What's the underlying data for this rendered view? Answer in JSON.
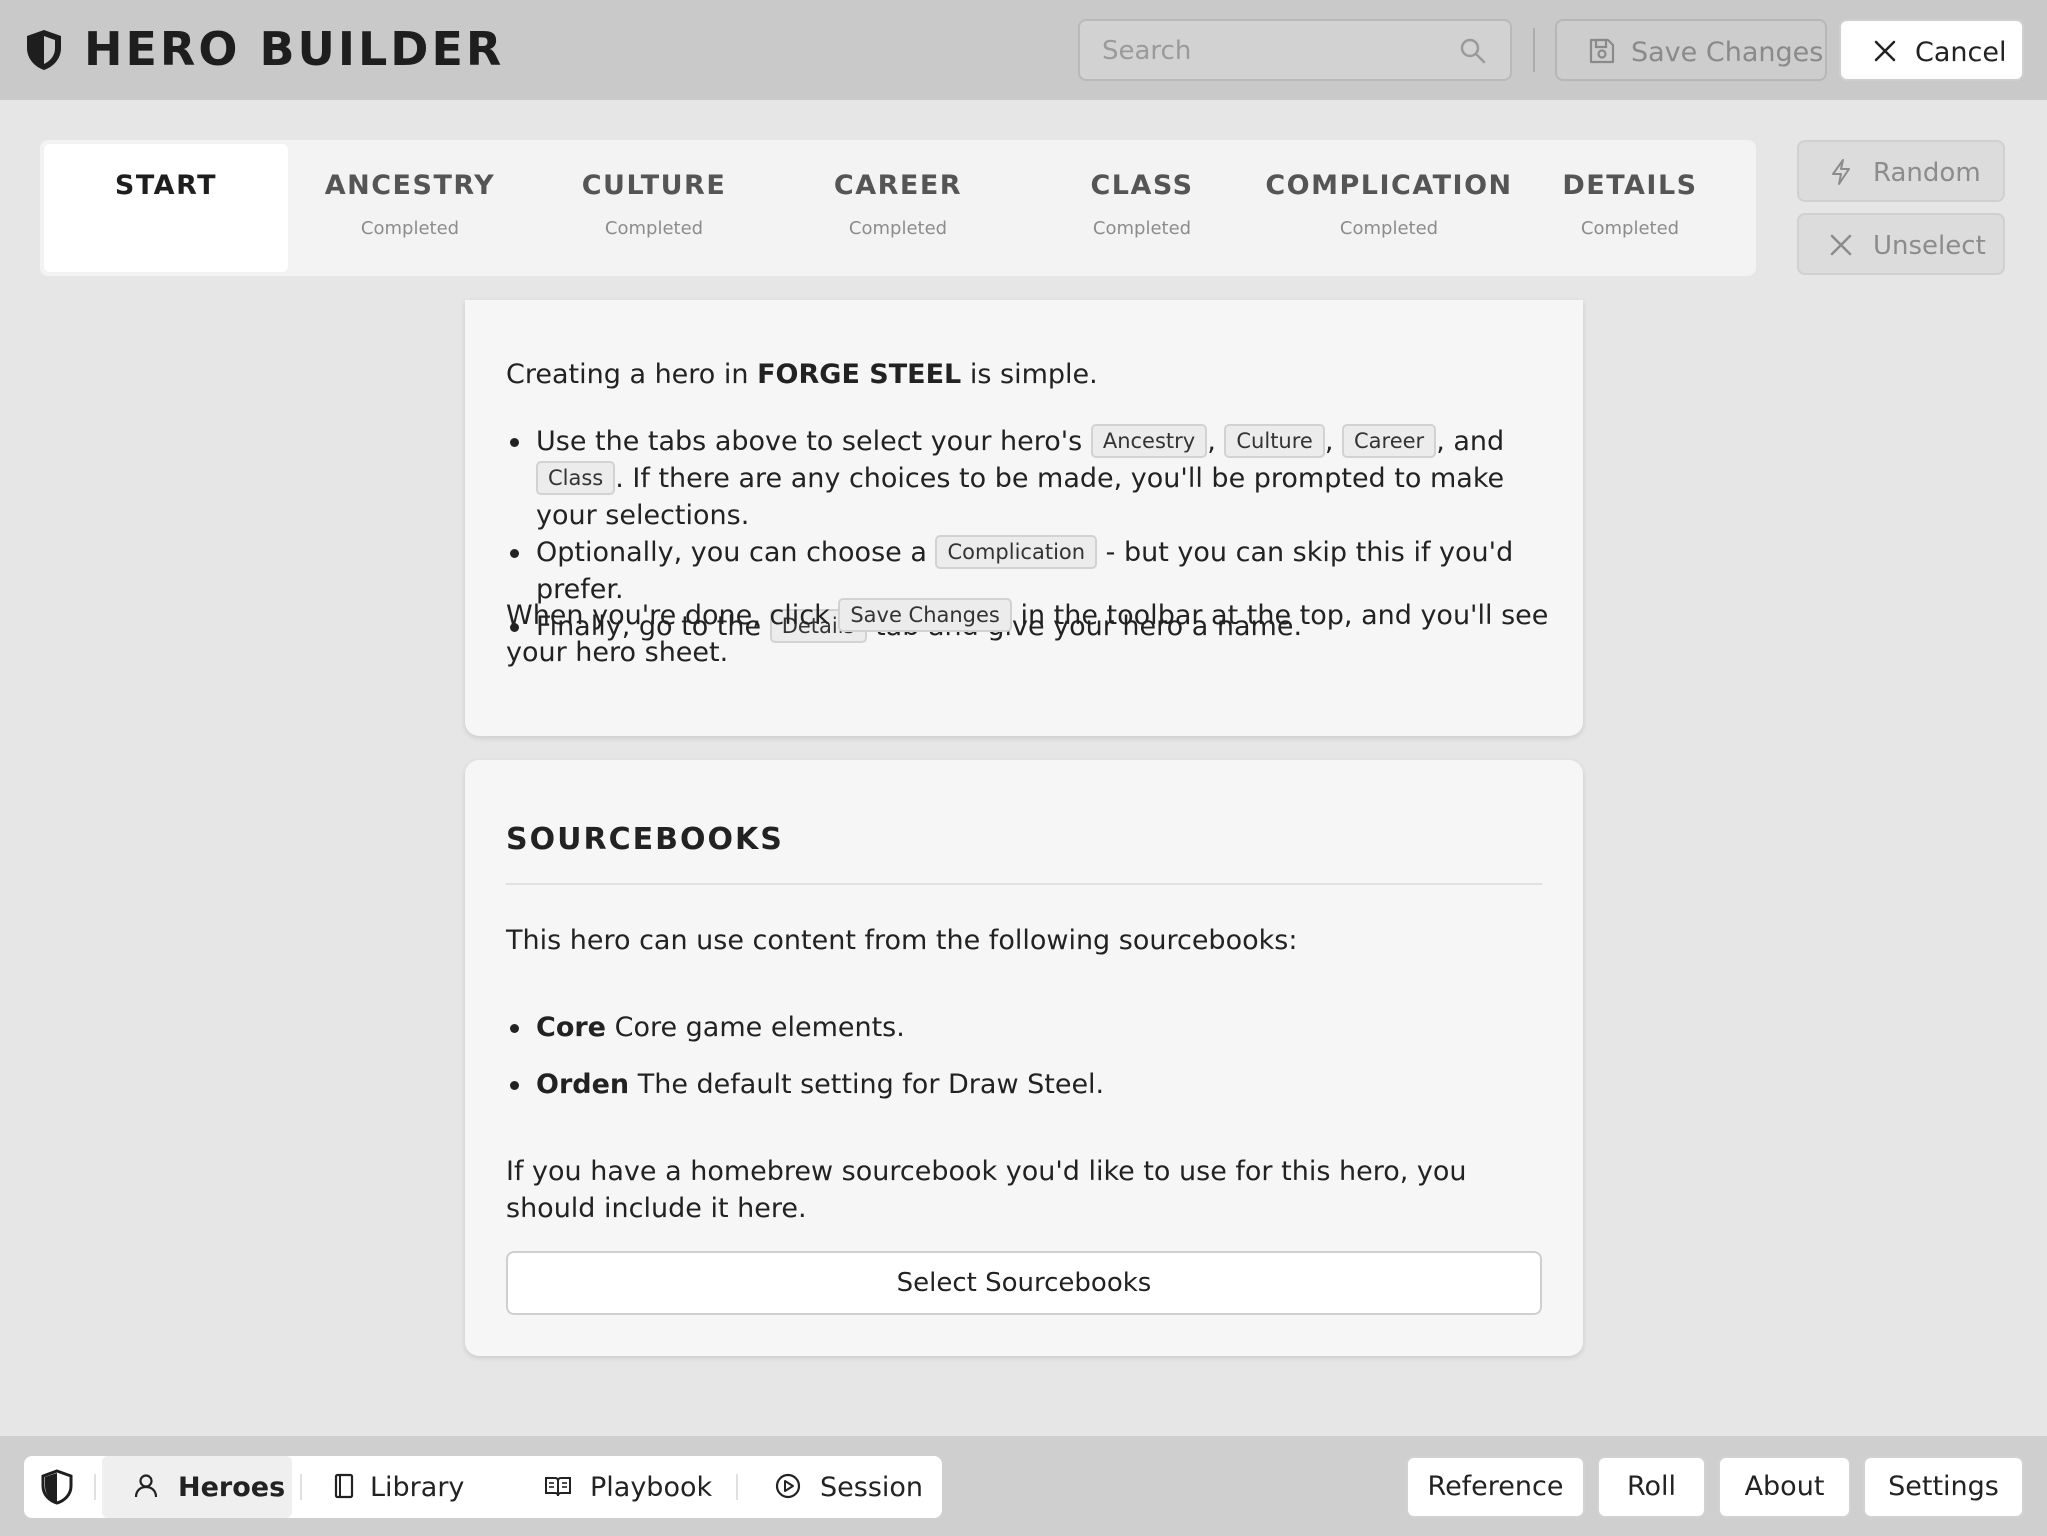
{
  "header": {
    "title": "HERO BUILDER",
    "search_placeholder": "Search",
    "save_label": "Save Changes",
    "cancel_label": "Cancel"
  },
  "steps": [
    {
      "name": "START",
      "status": ""
    },
    {
      "name": "ANCESTRY",
      "status": "Completed"
    },
    {
      "name": "CULTURE",
      "status": "Completed"
    },
    {
      "name": "CAREER",
      "status": "Completed"
    },
    {
      "name": "CLASS",
      "status": "Completed"
    },
    {
      "name": "COMPLICATION",
      "status": "Completed"
    },
    {
      "name": "DETAILS",
      "status": "Completed"
    }
  ],
  "side_actions": {
    "random_label": "Random",
    "unselect_label": "Unselect"
  },
  "start_card": {
    "intro_prefix": "Creating a hero in ",
    "intro_bold": "FORGE STEEL",
    "intro_suffix": " is simple.",
    "b1_text1": "Use the tabs above to select your hero's ",
    "chip_ancestry": "Ancestry",
    "comma1": ", ",
    "chip_culture": "Culture",
    "comma2": ", ",
    "chip_career": "Career",
    "and": ", and ",
    "chip_class": "Class",
    "b1_text2": ". If there are any choices to be made, you'll be prompted to make your selections.",
    "b2_text1": "Optionally, you can choose a ",
    "chip_complication": "Complication",
    "b2_text2": " - but you can skip this if you'd prefer.",
    "b3_text1": "Finally, go to the ",
    "chip_details": "Details",
    "b3_text2": " tab and give your hero a name.",
    "done_text1": "When you're done, click ",
    "chip_save": "Save Changes",
    "done_text2": " in the toolbar at the top, and you'll see your hero sheet."
  },
  "sourcebooks_card": {
    "heading": "SOURCEBOOKS",
    "intro": "This hero can use content from the following sourcebooks:",
    "books": [
      {
        "name": "Core",
        "description": "Core game elements."
      },
      {
        "name": "Orden",
        "description": "The default setting for Draw Steel."
      }
    ],
    "homebrew_note": "If you have a homebrew sourcebook you'd like to use for this hero, you should include it here.",
    "select_button": "Select Sourcebooks"
  },
  "bottom_nav": {
    "items": [
      {
        "label": "Heroes",
        "icon": "user-icon"
      },
      {
        "label": "Library",
        "icon": "book-icon"
      },
      {
        "label": "Playbook",
        "icon": "open-book-icon"
      },
      {
        "label": "Session",
        "icon": "play-circle-icon"
      }
    ],
    "buttons": [
      "Reference",
      "Roll",
      "About",
      "Settings"
    ]
  }
}
